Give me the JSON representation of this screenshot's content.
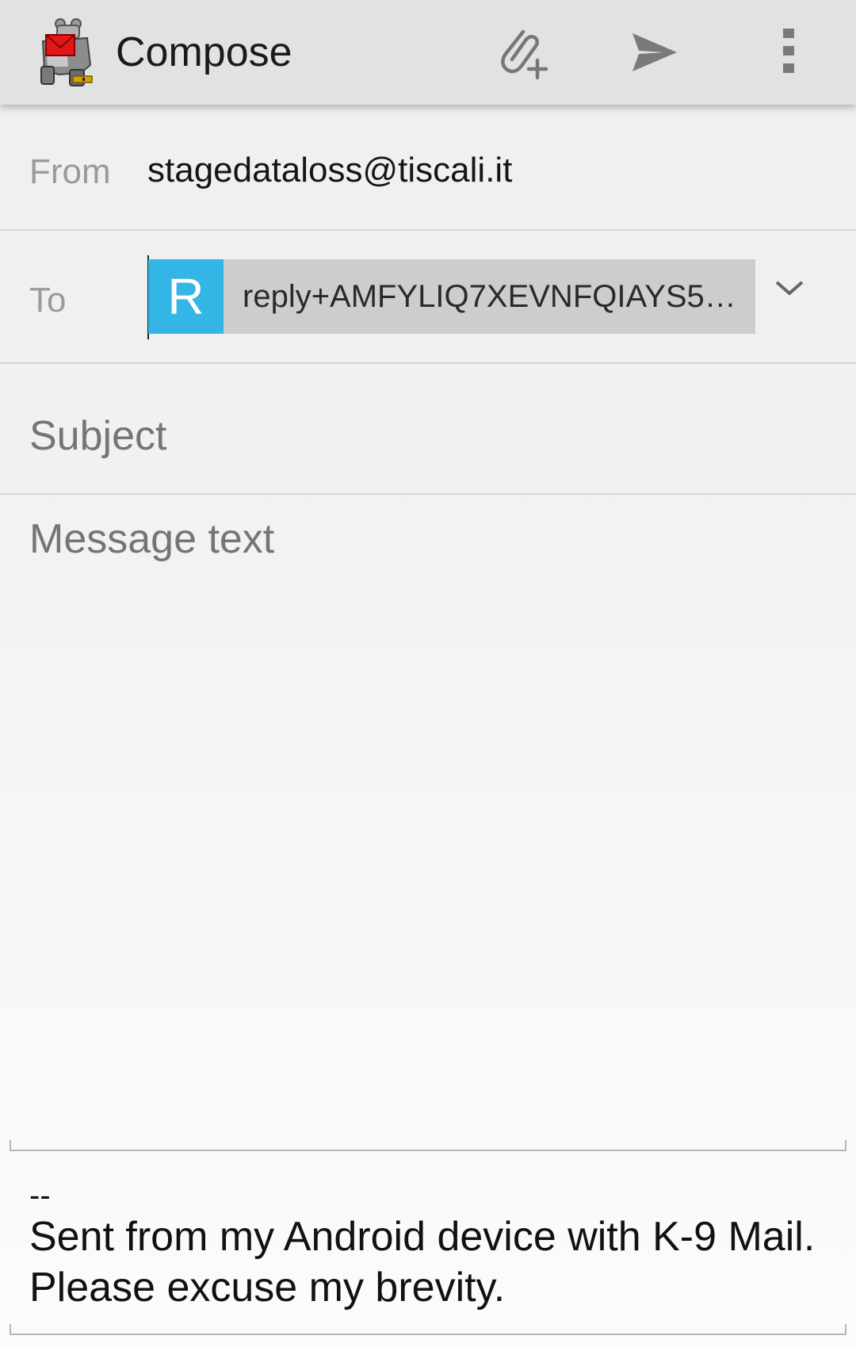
{
  "app_bar": {
    "title": "Compose",
    "logo_icon": "k9-mail-robot-dog-icon",
    "actions": [
      {
        "name": "attach-icon",
        "label": "Attach"
      },
      {
        "name": "send-icon",
        "label": "Send"
      },
      {
        "name": "overflow-menu-icon",
        "label": "More options"
      }
    ]
  },
  "from": {
    "label": "From",
    "value": "stagedataloss@tiscali.it"
  },
  "to": {
    "label": "To",
    "recipient": {
      "initial": "R",
      "address": "reply+AMFYLIQ7XEVNFQIAYS5…",
      "avatar_color": "#33b5e5"
    }
  },
  "subject": {
    "placeholder": "Subject",
    "value": ""
  },
  "message": {
    "placeholder": "Message text",
    "value": ""
  },
  "signature": {
    "separator": "--",
    "text": "Sent from my Android device with K-9 Mail. Please excuse my brevity."
  }
}
